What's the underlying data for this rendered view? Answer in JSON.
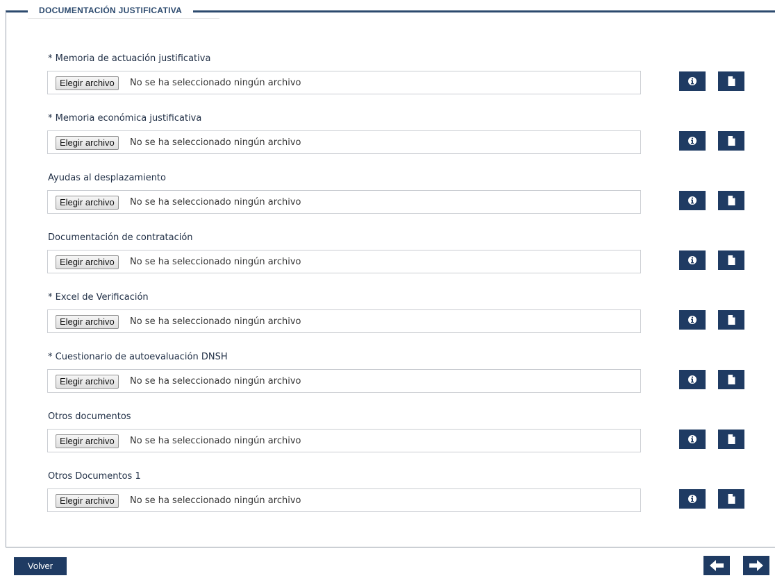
{
  "section": {
    "title": "DOCUMENTACIÓN JUSTIFICATIVA"
  },
  "fields": [
    {
      "label": "* Memoria de actuación justificativa",
      "button": "Elegir archivo",
      "status": "No se ha seleccionado ningún archivo"
    },
    {
      "label": "* Memoria económica justificativa",
      "button": "Elegir archivo",
      "status": "No se ha seleccionado ningún archivo"
    },
    {
      "label": "Ayudas al desplazamiento",
      "button": "Elegir archivo",
      "status": "No se ha seleccionado ningún archivo"
    },
    {
      "label": "Documentación de contratación",
      "button": "Elegir archivo",
      "status": "No se ha seleccionado ningún archivo"
    },
    {
      "label": "* Excel de Verificación",
      "button": "Elegir archivo",
      "status": "No se ha seleccionado ningún archivo"
    },
    {
      "label": "* Cuestionario de autoevaluación DNSH",
      "button": "Elegir archivo",
      "status": "No se ha seleccionado ningún archivo"
    },
    {
      "label": "Otros documentos",
      "button": "Elegir archivo",
      "status": "No se ha seleccionado ningún archivo"
    },
    {
      "label": "Otros Documentos 1",
      "button": "Elegir archivo",
      "status": "No se ha seleccionado ningún archivo"
    }
  ],
  "icons": {
    "info": "info-icon",
    "document": "document-icon",
    "prev": "arrow-left-icon",
    "next": "arrow-right-icon"
  },
  "footer": {
    "back_label": "Volver"
  },
  "colors": {
    "accent": "#1f3b63",
    "title": "#2c4a6e"
  }
}
